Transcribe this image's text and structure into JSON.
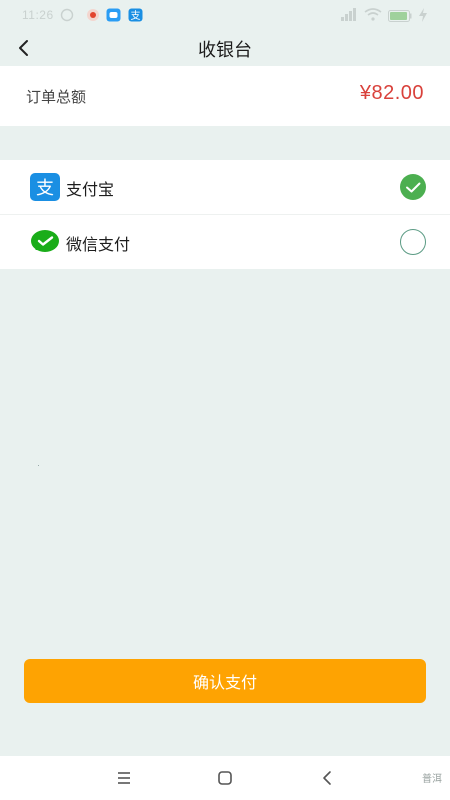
{
  "status_bar": {
    "time": "11:26",
    "battery": "86"
  },
  "header": {
    "title": "收银台"
  },
  "order": {
    "label": "订单总额",
    "amount": "¥82.00"
  },
  "payment_methods": [
    {
      "label": "支付宝",
      "icon": "alipay-icon",
      "selected": true
    },
    {
      "label": "微信支付",
      "icon": "wechat-pay-icon",
      "selected": false
    }
  ],
  "confirm": {
    "label": "确认支付"
  },
  "nav": {
    "watermark": "普洱"
  },
  "colors": {
    "accent": "#fea302",
    "price": "#d9413b",
    "check": "#4caf50",
    "alipay": "#1a8fe3",
    "wechat": "#1aad19",
    "background": "#e9f1ef"
  }
}
